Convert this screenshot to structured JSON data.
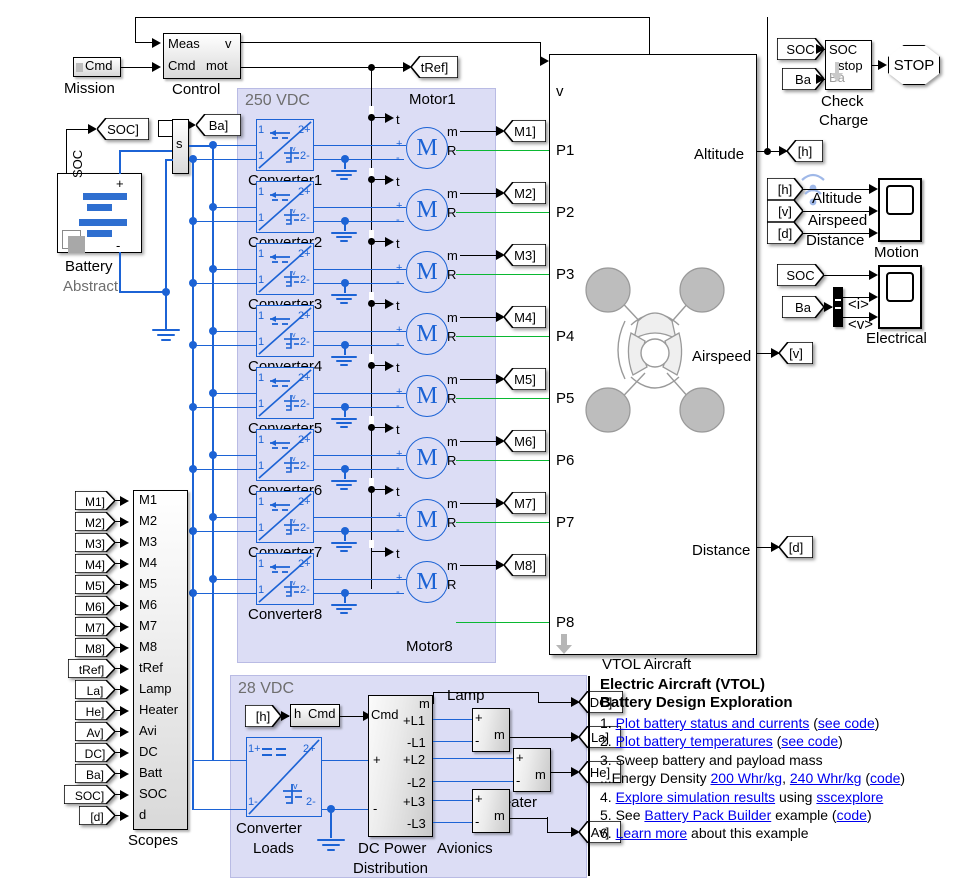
{
  "diagram": {
    "title_block": {
      "line1": "Electric Aircraft (VTOL)",
      "line2": "Battery Design Exploration",
      "items": [
        {
          "num": "1.",
          "parts": [
            {
              "t": "Plot battery status and currents",
              "link": true
            },
            {
              "t": " (",
              "link": false
            },
            {
              "t": "see code",
              "link": true
            },
            {
              "t": ")",
              "link": false
            }
          ]
        },
        {
          "num": "2.",
          "parts": [
            {
              "t": "Plot battery temperatures",
              "link": true
            },
            {
              "t": " (",
              "link": false
            },
            {
              "t": "see code",
              "link": true
            },
            {
              "t": ")",
              "link": false
            }
          ]
        },
        {
          "num": "3.",
          "parts": [
            {
              "t": "Sweep battery and payload mass",
              "link": false
            }
          ]
        },
        {
          "num": "",
          "parts": [
            {
              "t": "...Energy Density ",
              "link": false
            },
            {
              "t": "200 Whr/kg",
              "link": true
            },
            {
              "t": ", ",
              "link": false
            },
            {
              "t": "240 Whr/kg",
              "link": true
            },
            {
              "t": " (",
              "link": false
            },
            {
              "t": "code",
              "link": true
            },
            {
              "t": ")",
              "link": false
            }
          ]
        },
        {
          "num": "4.",
          "parts": [
            {
              "t": "Explore simulation results",
              "link": true
            },
            {
              "t": " using ",
              "link": false
            },
            {
              "t": "sscexplore",
              "link": true
            }
          ]
        },
        {
          "num": "5.",
          "parts": [
            {
              "t": "See ",
              "link": false
            },
            {
              "t": "Battery Pack Builder",
              "link": true
            },
            {
              "t": " example (",
              "link": false
            },
            {
              "t": "code",
              "link": true
            },
            {
              "t": ")",
              "link": false
            }
          ]
        },
        {
          "num": "6.",
          "parts": [
            {
              "t": "Learn more",
              "link": true
            },
            {
              "t": " about this example",
              "link": false
            }
          ]
        }
      ]
    },
    "panels": {
      "hv": {
        "label": "250 VDC"
      },
      "lv": {
        "label": "28 VDC"
      }
    },
    "blocks": {
      "mission": {
        "label": "Mission",
        "port": "Cmd"
      },
      "control": {
        "label": "Control",
        "in": [
          "Meas",
          "Cmd"
        ],
        "out": [
          "v",
          "mot"
        ]
      },
      "battery": {
        "label": "Battery",
        "sublabel": "Abstract",
        "soc": "SOC",
        "plus": "+",
        "minus": "-"
      },
      "check_charge": {
        "label_l1": "Check",
        "label_l2": "Charge",
        "in": [
          "SOC",
          "Ba"
        ],
        "out": "stop"
      },
      "stop_sign": {
        "label": "STOP"
      },
      "vtol": {
        "label": "VTOL Aircraft",
        "in_v": "v",
        "in_ports": [
          "P1",
          "P2",
          "P3",
          "P4",
          "P5",
          "P6",
          "P7",
          "P8"
        ],
        "out_ports": [
          "Altitude",
          "Airspeed",
          "Distance"
        ]
      },
      "motion_scope": {
        "label": "Motion",
        "signals": [
          "Altitude",
          "Airspeed",
          "Distance"
        ],
        "froms": [
          "[h]",
          "[v]",
          "[d]"
        ]
      },
      "electrical_scope": {
        "label": "Electrical",
        "signals": [
          "<i>",
          "<v>"
        ],
        "froms": [
          "SOC",
          "Ba"
        ]
      },
      "scopes": {
        "label": "Scopes",
        "rows": [
          {
            "from": "M1]",
            "port": "M1"
          },
          {
            "from": "M2]",
            "port": "M2"
          },
          {
            "from": "M3]",
            "port": "M3"
          },
          {
            "from": "M4]",
            "port": "M4"
          },
          {
            "from": "M5]",
            "port": "M5"
          },
          {
            "from": "M6]",
            "port": "M6"
          },
          {
            "from": "M7]",
            "port": "M7"
          },
          {
            "from": "M8]",
            "port": "M8"
          },
          {
            "from": "tRef]",
            "port": "tRef"
          },
          {
            "from": "La]",
            "port": "Lamp"
          },
          {
            "from": "He]",
            "port": "Heater"
          },
          {
            "from": "Av]",
            "port": "Avi"
          },
          {
            "from": "DC]",
            "port": "DC"
          },
          {
            "from": "Ba]",
            "port": "Batt"
          },
          {
            "from": "SOC]",
            "port": "SOC"
          },
          {
            "from": "[d]",
            "port": "d"
          }
        ]
      },
      "converter_loads": {
        "label_l1": "Converter",
        "label_l2": "Loads",
        "ports": [
          "1+",
          "2+",
          "1-",
          "2-"
        ],
        "sym": "v"
      },
      "dc_power": {
        "label_l1": "DC Power",
        "label_l2": "Distribution",
        "in": [
          "Cmd",
          "+",
          "-"
        ],
        "out_m": "m",
        "out_ports": [
          "+L1",
          "-L1",
          "+L2",
          "-L2",
          "+L3",
          "-L3"
        ]
      },
      "lamp": {
        "label": "Lamp",
        "ports": [
          "+",
          "-"
        ],
        "out": "m"
      },
      "heater": {
        "label": "Heater",
        "ports": [
          "+",
          "-"
        ],
        "out": "m"
      },
      "avionics": {
        "label": "Avionics",
        "ports": [
          "+",
          "-"
        ],
        "out": "m"
      },
      "h_cmd": {
        "in": "h",
        "out": "Cmd"
      },
      "switch_s": {
        "label": "s"
      }
    },
    "converters": {
      "labels": [
        "Converter1",
        "Converter2",
        "Converter3",
        "Converter4",
        "Converter5",
        "Converter6",
        "Converter7",
        "Converter8"
      ],
      "ports": [
        "1",
        "2+",
        "1",
        "2-"
      ],
      "sym": "v"
    },
    "motors": {
      "first_label": "Motor1",
      "last_label": "Motor8",
      "glyph": "M",
      "in_t": "t",
      "in_plus": "+",
      "in_minus": "-",
      "out_m": "m",
      "out_R": "R",
      "tags": [
        "M1]",
        "M2]",
        "M3]",
        "M4]",
        "M5]",
        "M6]",
        "M7]",
        "M8]"
      ]
    },
    "tags": {
      "soc_goto": "SOC]",
      "ba_goto": "Ba]",
      "tref_goto": "tRef]",
      "soc_from": "SOC",
      "ba_from": "Ba",
      "h_goto": "[h]",
      "h_from": "[h]",
      "v_from": "[v]",
      "d_from": "[d]",
      "v_goto": "[v]",
      "d_goto": "[d]",
      "dc_goto": "DC]",
      "la_goto": "La]",
      "he_goto": "He]",
      "av_goto": "Av]",
      "h_lv_from": "[h]"
    },
    "colors": {
      "panel_fill": "#dcddf5",
      "electrical_wire": "#1c63d5",
      "mech_wire": "#0ab832",
      "signal_wire": "#000000",
      "link": "#0000ee"
    }
  }
}
